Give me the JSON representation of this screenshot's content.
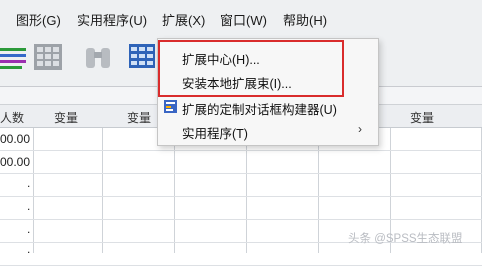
{
  "menubar": {
    "items": [
      {
        "label": "图形(G)"
      },
      {
        "label": "实用程序(U)"
      },
      {
        "label": "扩展(X)"
      },
      {
        "label": "窗口(W)"
      },
      {
        "label": "帮助(H)"
      }
    ]
  },
  "grid": {
    "first_col_header": "人数",
    "col_header": "变量",
    "rows": [
      "00.00",
      "00.00",
      ".",
      ".",
      ".",
      "."
    ]
  },
  "extensions_menu": {
    "items": [
      {
        "label": "扩展中心(H)..."
      },
      {
        "label": "安装本地扩展束(I)..."
      },
      {
        "label": "扩展的定制对话框构建器(U)"
      },
      {
        "label": "实用程序(T)",
        "submenu_icon": "chevron-right-icon"
      }
    ]
  },
  "watermark": "头条 @SPSS生态联盟",
  "colors": {
    "highlight": "#d92c2c",
    "menu_bg": "#f7f7f7"
  }
}
